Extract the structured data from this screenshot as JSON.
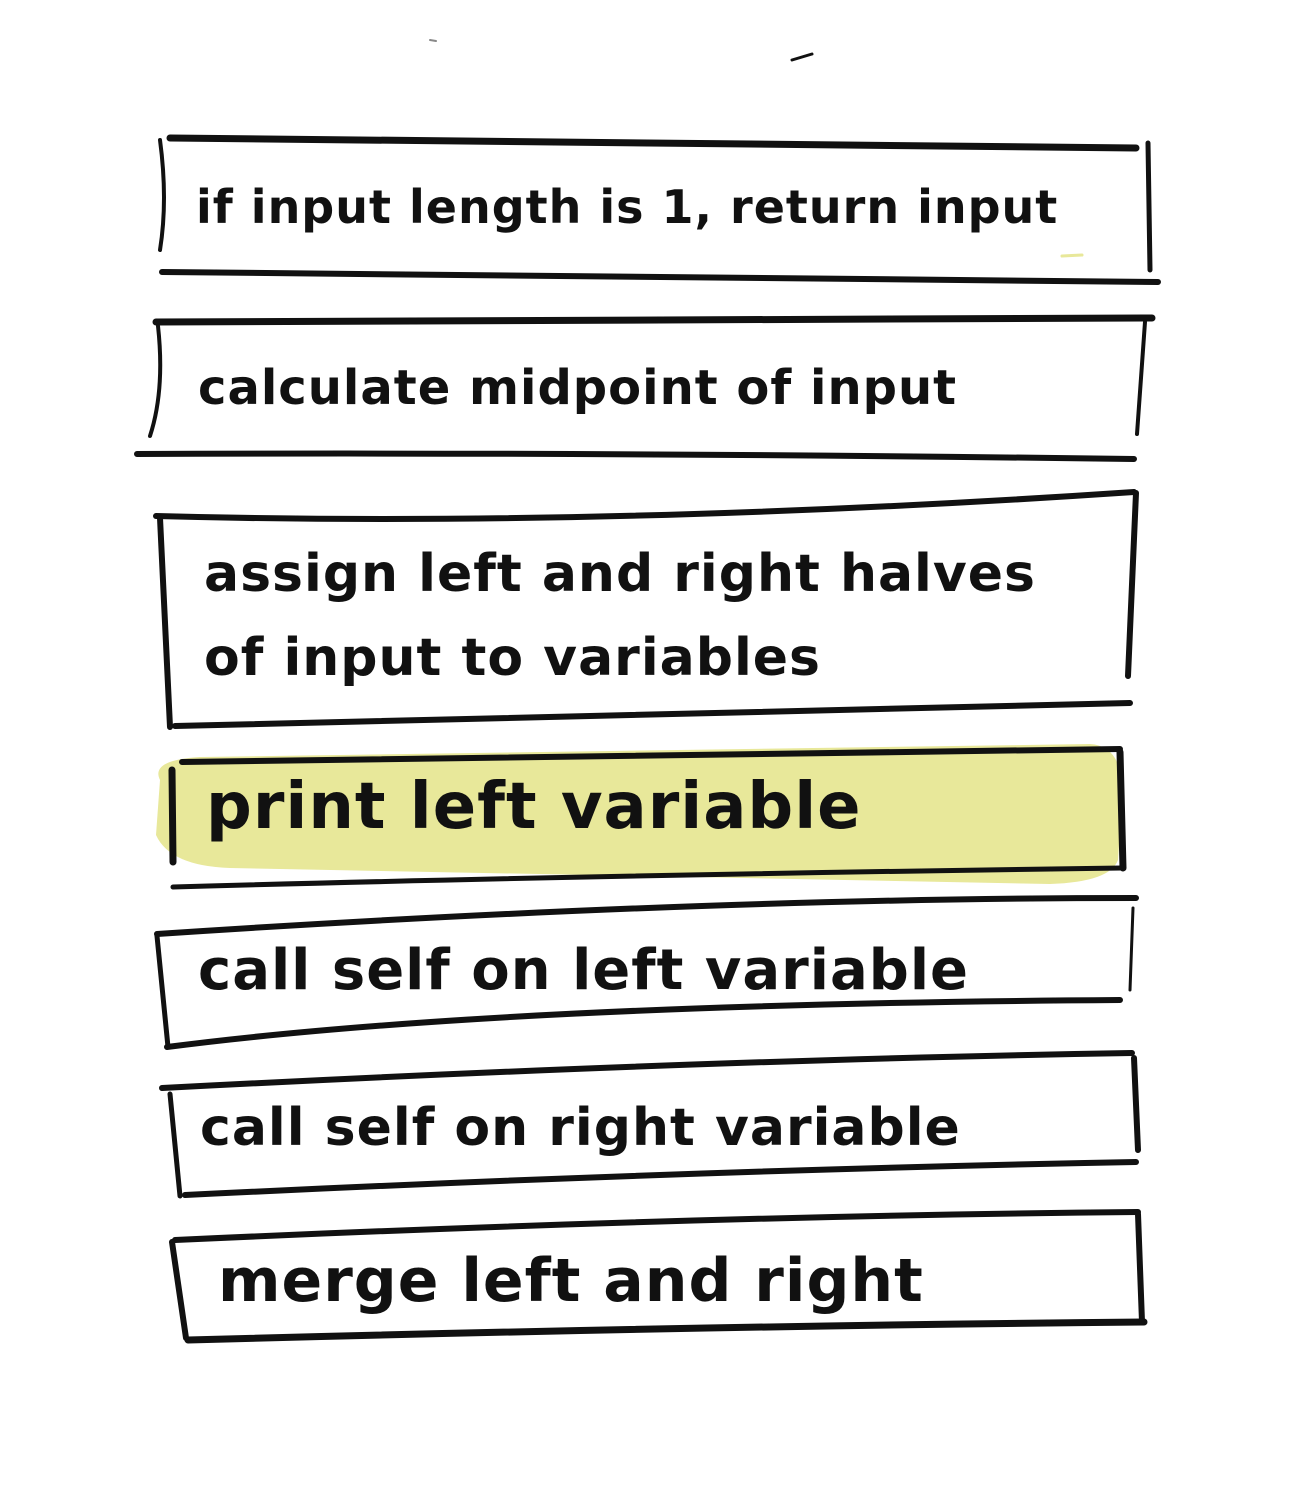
{
  "steps": [
    {
      "id": "step-1",
      "text": "if input length is 1, return input",
      "highlighted": false
    },
    {
      "id": "step-2",
      "text": "calculate midpoint of input",
      "highlighted": false
    },
    {
      "id": "step-3",
      "text": "assign left and right halves of input to variables",
      "highlighted": false
    },
    {
      "id": "step-4",
      "text": "print left variable",
      "highlighted": true
    },
    {
      "id": "step-5",
      "text": "call self on left variable",
      "highlighted": false
    },
    {
      "id": "step-6",
      "text": "call self on right variable",
      "highlighted": false
    },
    {
      "id": "step-7",
      "text": "merge left and right",
      "highlighted": false
    }
  ],
  "colors": {
    "ink": "#111111",
    "highlight": "#e8e89a",
    "background": "#ffffff"
  }
}
